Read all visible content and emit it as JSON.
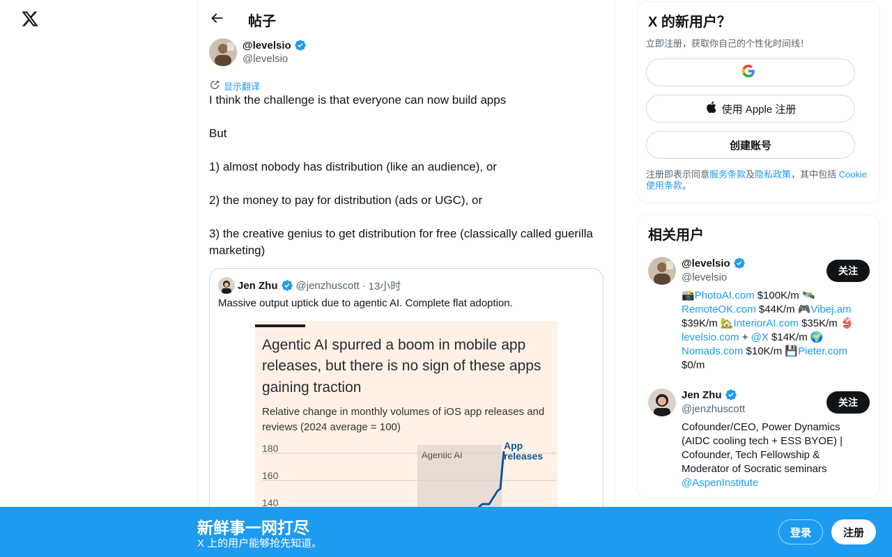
{
  "nav": {
    "logo_icon": "x-logo-icon"
  },
  "header": {
    "title": "帖子"
  },
  "post": {
    "author_name": "@levelsio",
    "author_handle": "@levelsio",
    "translate_label": "显示翻译",
    "lines": [
      "I think the challenge is that everyone can now build apps",
      "",
      "But",
      "",
      "1) almost nobody has distribution (like an audience), or",
      "",
      "2) the money to pay for distribution (ads or UGC), or",
      "",
      "3) the creative genius to get distribution for free (classically called guerilla marketing)"
    ]
  },
  "quote": {
    "name": "Jen Zhu",
    "handle": "@jenzhuscott",
    "dot": "·",
    "time": "13小时",
    "text": "Massive output uptick due to agentic AI. Complete flat adoption.",
    "image": {
      "title": "Agentic AI spurred a boom in mobile app releases, but there is no sign of these apps gaining traction",
      "subtitle": "Relative change in monthly volumes of iOS app releases and reviews (2024 average = 100)",
      "shaded_label": "Agentic AI",
      "series_label": "App releases",
      "ticks": [
        "180",
        "160",
        "140"
      ]
    }
  },
  "signup": {
    "title": "X 的新用户？",
    "subtitle": "立即注册，获取你自己的个性化时间线！",
    "google_label": "",
    "apple_label": "使用 Apple 注册",
    "create_label": "创建账号",
    "terms_prefix": "注册即表示同意",
    "terms_link1": "服务条款",
    "terms_and": "及",
    "terms_link2": "隐私政策",
    "terms_mid": "，其中包括 ",
    "terms_link3": "Cookie 使用条款",
    "terms_end": "。"
  },
  "related": {
    "title": "相关用户",
    "users": [
      {
        "name": "@levelsio",
        "handle": "@levelsio",
        "follow_label": "关注",
        "bio": [
          {
            "t": "📸",
            "l": false
          },
          {
            "t": "PhotoAI.com",
            "l": true
          },
          {
            "t": " $100K/m 🛰️ ",
            "l": false
          },
          {
            "t": "RemoteOK.com",
            "l": true
          },
          {
            "t": " $44K/m 🎮",
            "l": false
          },
          {
            "t": "Vibej.am",
            "l": true
          },
          {
            "t": " $39K/m 🏡",
            "l": false
          },
          {
            "t": "InteriorAI.com",
            "l": true
          },
          {
            "t": " $35K/m 👙 ",
            "l": false
          },
          {
            "t": "levelsio.com",
            "l": true
          },
          {
            "t": " + ",
            "l": false
          },
          {
            "t": "@X",
            "l": true
          },
          {
            "t": " $14K/m 🌍 ",
            "l": false
          },
          {
            "t": "Nomads.com",
            "l": true
          },
          {
            "t": " $10K/m 💾",
            "l": false
          },
          {
            "t": "Pieter.com",
            "l": true
          },
          {
            "t": " $0/m",
            "l": false
          }
        ]
      },
      {
        "name": "Jen Zhu",
        "handle": "@jenzhuscott",
        "follow_label": "关注",
        "bio": [
          {
            "t": "Cofounder/CEO, Power Dynamics (AIDC cooling tech + ESS BYOE) | Cofounder, Tech Fellowship & Moderator of Socratic seminars ",
            "l": false
          },
          {
            "t": "@AspenInstitute",
            "l": true
          }
        ]
      }
    ]
  },
  "bottom_bar": {
    "title": "新鲜事一网打尽",
    "subtitle": "X 上的用户能够抢先知道。",
    "login_label": "登录",
    "signup_label": "注册"
  },
  "colors": {
    "accent": "#1d9bf0",
    "text": "#0f1419",
    "muted": "#536471"
  }
}
